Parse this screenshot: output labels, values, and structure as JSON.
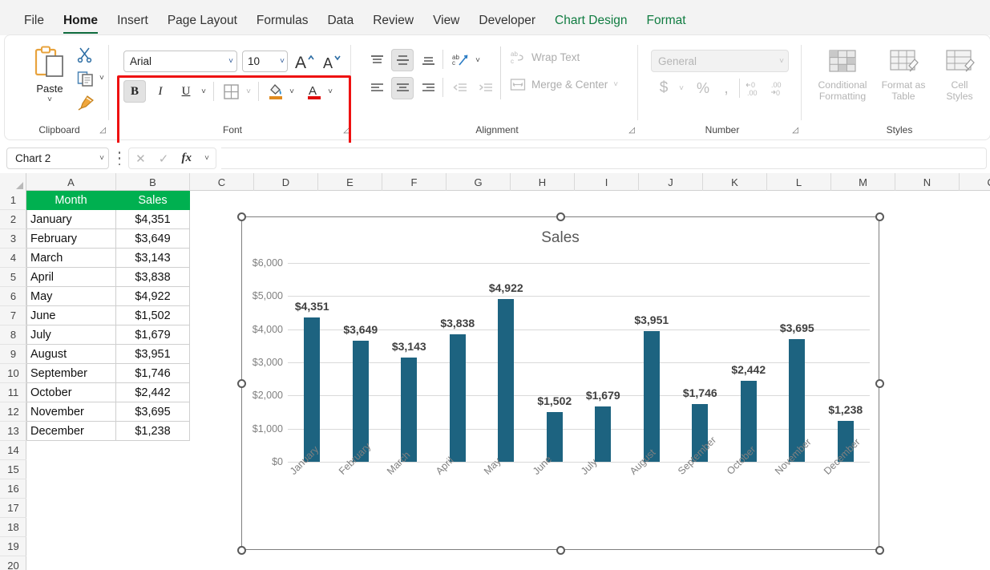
{
  "tabs": [
    {
      "label": "File",
      "state": "normal"
    },
    {
      "label": "Home",
      "state": "active"
    },
    {
      "label": "Insert",
      "state": "normal"
    },
    {
      "label": "Page Layout",
      "state": "normal"
    },
    {
      "label": "Formulas",
      "state": "normal"
    },
    {
      "label": "Data",
      "state": "normal"
    },
    {
      "label": "Review",
      "state": "normal"
    },
    {
      "label": "View",
      "state": "normal"
    },
    {
      "label": "Developer",
      "state": "normal"
    },
    {
      "label": "Chart Design",
      "state": "contextual"
    },
    {
      "label": "Format",
      "state": "contextual"
    }
  ],
  "ribbon": {
    "clipboard": {
      "group_label": "Clipboard",
      "paste_label": "Paste"
    },
    "font": {
      "group_label": "Font",
      "font_name": "Arial",
      "font_size": "10",
      "bold_label": "B",
      "italic_label": "I",
      "underline_label": "U",
      "grow_label": "A",
      "shrink_label": "A"
    },
    "alignment": {
      "group_label": "Alignment",
      "wrap_text_label": "Wrap Text",
      "merge_center_label": "Merge & Center"
    },
    "number": {
      "group_label": "Number",
      "format_value": "General",
      "currency_label": "$",
      "percent_label": "%",
      "comma_label": "❙"
    },
    "styles": {
      "group_label": "Styles",
      "conditional_formatting_label": "Conditional\nFormatting",
      "format_as_table_label": "Format as\nTable",
      "cell_styles_label": "Cell\nStyles"
    }
  },
  "formula_bar": {
    "name_box_value": "Chart 2",
    "formula_value": "",
    "fx_label": "fx"
  },
  "grid": {
    "columns": [
      "A",
      "B",
      "C",
      "D",
      "E",
      "F",
      "G",
      "H",
      "I",
      "J",
      "K",
      "L",
      "M",
      "N",
      "O"
    ],
    "rows": [
      "1",
      "2",
      "3",
      "4",
      "5",
      "6",
      "7",
      "8",
      "9",
      "10",
      "11",
      "12",
      "13",
      "14",
      "15",
      "16",
      "17",
      "18",
      "19",
      "20"
    ],
    "headers": {
      "month": "Month",
      "sales": "Sales"
    },
    "months": [
      "January",
      "February",
      "March",
      "April",
      "May",
      "June",
      "July",
      "August",
      "September",
      "October",
      "November",
      "December"
    ],
    "sales_text": [
      "$4,351",
      "$3,649",
      "$3,143",
      "$3,838",
      "$4,922",
      "$1,502",
      "$1,679",
      "$3,951",
      "$1,746",
      "$2,442",
      "$3,695",
      "$1,238"
    ],
    "header_bg": "#00b050"
  },
  "chart_data": {
    "type": "bar",
    "title": "Sales",
    "xlabel": "",
    "ylabel": "",
    "categories": [
      "January",
      "February",
      "March",
      "April",
      "May",
      "June",
      "July",
      "August",
      "September",
      "October",
      "November",
      "December"
    ],
    "values": [
      4351,
      3649,
      3143,
      3838,
      4922,
      1502,
      1679,
      3951,
      1746,
      2442,
      3695,
      1238
    ],
    "data_labels": [
      "$4,351",
      "$3,649",
      "$3,143",
      "$3,838",
      "$4,922",
      "$1,502",
      "$1,679",
      "$3,951",
      "$1,746",
      "$2,442",
      "$3,695",
      "$1,238"
    ],
    "ylim": [
      0,
      6000
    ],
    "yticks": [
      0,
      1000,
      2000,
      3000,
      4000,
      5000,
      6000
    ],
    "ytick_labels": [
      "$0",
      "$1,000",
      "$2,000",
      "$3,000",
      "$4,000",
      "$5,000",
      "$6,000"
    ],
    "grid": true,
    "legend": false,
    "series_color": "#1d6380",
    "selected": true
  }
}
